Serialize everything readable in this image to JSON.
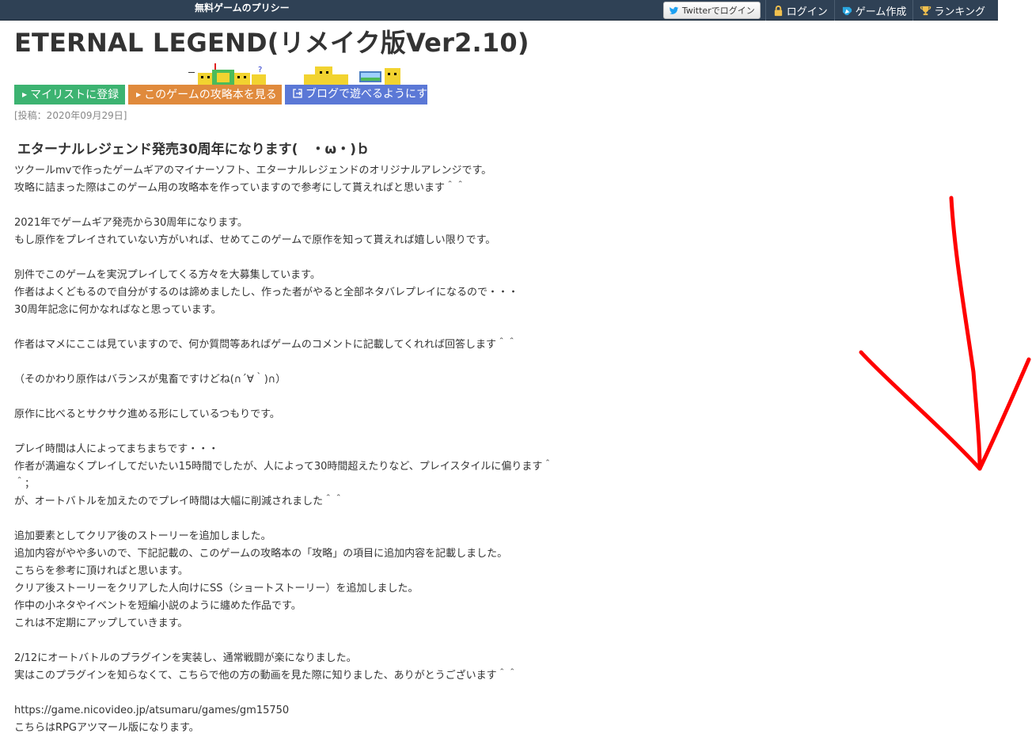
{
  "header": {
    "site_name": "無料ゲームのプリシー",
    "twitter_login": "Twitterでログイン",
    "nav": [
      {
        "label": "ログイン",
        "icon": "lock-icon"
      },
      {
        "label": "ゲーム作成",
        "icon": "pen-icon"
      },
      {
        "label": "ランキング",
        "icon": "trophy-icon"
      }
    ]
  },
  "game": {
    "title": "ETERNAL LEGEND(リメイク版Ver2.10)",
    "buttons": {
      "mylist": "マイリストに登録",
      "guide": "このゲームの攻略本を見る",
      "blog": "ブログで遊べるようにする"
    },
    "posted": "[投稿：2020年09月29日]",
    "subtitle": "エターナルレジェンド発売30周年になります(　・ω・)ｂ",
    "description_lines": [
      "ツクールmvで作ったゲームギアのマイナーソフト、エターナルレジェンドのオリジナルアレンジです。",
      "攻略に詰まった際はこのゲーム用の攻略本を作っていますので参考にして貰えればと思います＾＾",
      "",
      "2021年でゲームギア発売から30周年になります。",
      "もし原作をプレイされていない方がいれば、せめてこのゲームで原作を知って貰えれば嬉しい限りです。",
      "",
      "別件でこのゲームを実況プレイしてくる方々を大募集しています。",
      "作者はよくどもるので自分がするのは諦めましたし、作った者がやると全部ネタバレプレイになるので・・・",
      "30周年記念に何かなればなと思っています。",
      "",
      "作者はマメにここは見ていますので、何か質問等あればゲームのコメントに記載してくれれば回答します＾＾",
      "",
      "（そのかわり原作はバランスが鬼畜ですけどね(∩´∀｀)∩）",
      "",
      "原作に比べるとサクサク進める形にしているつもりです。",
      "",
      "プレイ時間は人によってまちまちです・・・",
      "作者が満遍なくプレイしてだいたい15時間でしたが、人によって30時間超えたりなど、プレイスタイルに偏ります＾",
      "＾；",
      "が、オートバトルを加えたのでプレイ時間は大幅に削減されました＾＾",
      "",
      "追加要素としてクリア後のストーリーを追加しました。",
      "追加内容がやや多いので、下記記載の、このゲームの攻略本の「攻略」の項目に追加内容を記載しました。",
      "こちらを参考に頂ければと思います。",
      "クリア後ストーリーをクリアした人向けにSS（ショートストーリー）を追加しました。",
      "作中の小ネタやイベントを短編小説のように纏めた作品です。",
      "これは不定期にアップしていきます。",
      "",
      "2/12にオートバトルのプラグインを実装し、通常戦闘が楽になりました。",
      "実はこのプラグインを知らなくて、こちらで他の方の動画を見た際に知りました、ありがとうございます＾＾",
      "",
      "https://game.nicovideo.jp/atsumaru/games/gm15750",
      "こちらはRPGアツマール版になります。"
    ]
  },
  "colors": {
    "topbar": "#2f4155",
    "mylist": "#3cb371",
    "guide": "#e08a3c",
    "blog": "#5b78d6",
    "annotation": "#ff0000"
  }
}
